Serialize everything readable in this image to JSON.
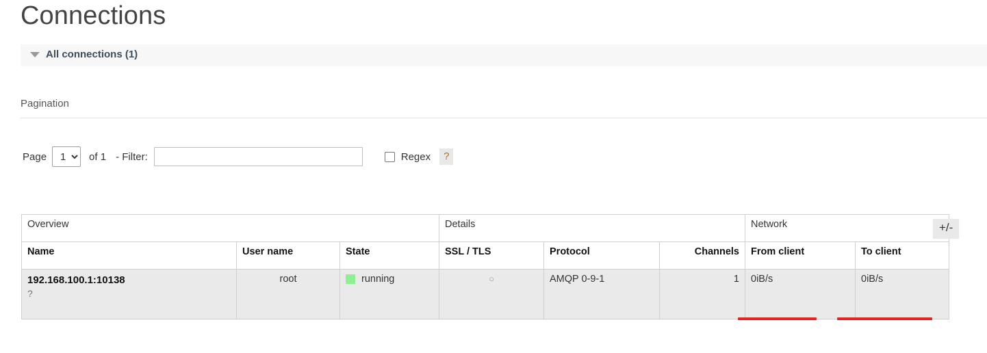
{
  "page": {
    "title": "Connections"
  },
  "section": {
    "toggle_icon": "triangle-down-icon",
    "label": "All connections (1)"
  },
  "pagination": {
    "title": "Pagination",
    "page_label": "Page",
    "page_value": "1",
    "page_options": [
      "1"
    ],
    "of_label": "of 1",
    "filter_label": "- Filter:",
    "filter_value": "",
    "filter_placeholder": "",
    "regex_label": "Regex",
    "regex_checked": false,
    "help_badge": "?"
  },
  "table": {
    "group_headers": [
      "Overview",
      "Details",
      "Network"
    ],
    "columns": [
      "Name",
      "User name",
      "State",
      "SSL / TLS",
      "Protocol",
      "Channels",
      "From client",
      "To client"
    ],
    "rows": [
      {
        "name": "192.168.100.1:10138",
        "name_help": "?",
        "user_name": "root",
        "state": "running",
        "state_color": "#8ff08f",
        "ssl_tls": "○",
        "protocol": "AMQP 0-9-1",
        "channels": "1",
        "from_client": "0iB/s",
        "to_client": "0iB/s"
      }
    ],
    "plusminus_label": "+/-",
    "sparkline_color": "#e52421"
  }
}
